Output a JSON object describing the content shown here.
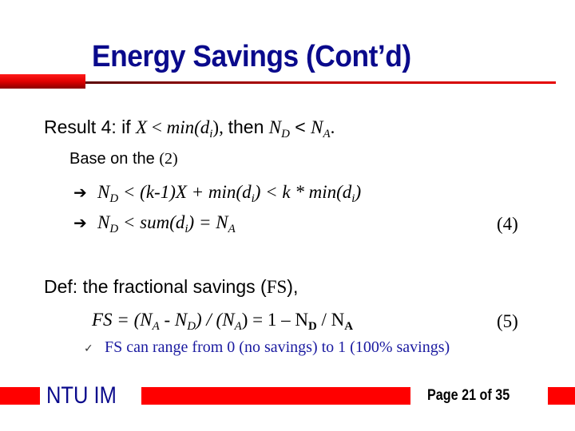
{
  "slide": {
    "title": "Energy Savings (Cont’d)",
    "result": {
      "prefix": "Result 4: if ",
      "cond_x": "X",
      "cond_lt": " < ",
      "cond_min": "min(d",
      "cond_min_sub": "i",
      "cond_close": "), ",
      "then": "then ",
      "nd": "N",
      "nd_sub": "D",
      "lt": " < ",
      "na": "N",
      "na_sub": "A",
      "end": "."
    },
    "base": {
      "text": "Base on the ",
      "ref": "(2)"
    },
    "derivation": [
      {
        "arrow_icon": "right-arrow-icon",
        "n": "N",
        "n_sub": "D",
        "rest1": " < (k-1)X + min(d",
        "sub1": "i",
        "rest2": ") < k * min(d",
        "sub2": "i",
        "rest3": ")"
      },
      {
        "arrow_icon": "right-arrow-icon",
        "n": "N",
        "n_sub": "D",
        "rest1": " < sum(d",
        "sub1": "i",
        "rest2": ") = N",
        "sub2": "A",
        "equation_number": "(4)"
      }
    ],
    "definition": {
      "prefix": "Def: the fractional savings (",
      "abbr": "FS",
      "suffix": "),"
    },
    "formula": {
      "lhs": "FS = (N",
      "s1": "A",
      "p2": " - N",
      "s2": "D",
      "p3": ") / (N",
      "s3": "A",
      "p4": ") = 1 – N",
      "s4": "D",
      "p5": " / N",
      "s5": "A",
      "equation_number": "(5)"
    },
    "note": {
      "check_icon": "checkmark-icon",
      "text": "FS can range from 0 (no savings) to 1 (100% savings)"
    }
  },
  "footer": {
    "org": "NTU IM",
    "page_label": "Page 21 of 35"
  },
  "colors": {
    "title": "#0a0a8c",
    "accent_red": "#ff0000",
    "note": "#1a1aa0"
  }
}
